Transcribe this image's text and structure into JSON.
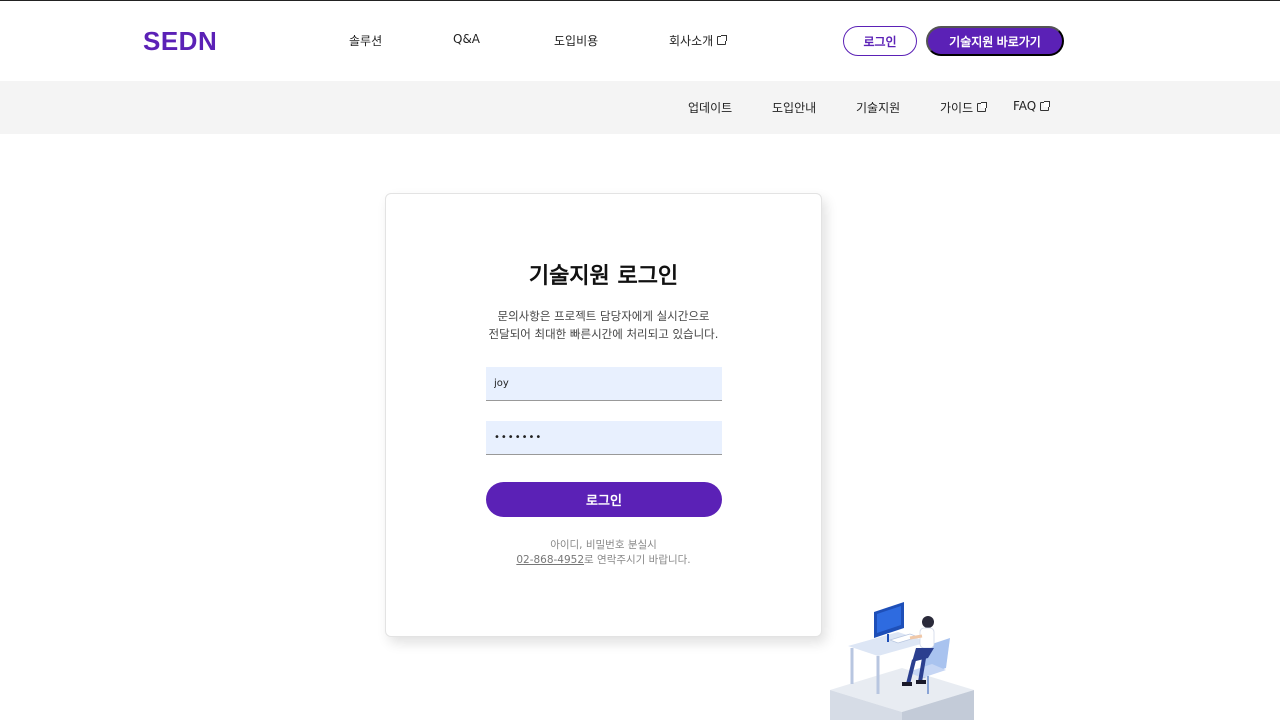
{
  "header": {
    "logo": "SEDN",
    "nav": [
      {
        "label": "솔루션",
        "external": false
      },
      {
        "label": "Q&A",
        "external": false
      },
      {
        "label": "도입비용",
        "external": false
      },
      {
        "label": "회사소개",
        "external": true
      }
    ],
    "login_button": "로그인",
    "tech_button": "기술지원 바로가기"
  },
  "subnav": [
    {
      "label": "업데이트",
      "external": false
    },
    {
      "label": "도입안내",
      "external": false
    },
    {
      "label": "기술지원",
      "external": false
    },
    {
      "label": "가이드",
      "external": true
    },
    {
      "label": "FAQ",
      "external": true
    }
  ],
  "login_card": {
    "title": "기술지원 로그인",
    "description_line1": "문의사항은 프로젝트 담당자에게 실시간으로",
    "description_line2": "전달되어 최대한 빠른시간에 처리되고 있습니다.",
    "username_value": "joy",
    "password_value": "•••••••",
    "submit_label": "로그인",
    "help_line1": "아이디, 비밀번호 분실시",
    "help_phone": "02-868-4952",
    "help_line2_suffix": "로 연락주시기 바랍니다."
  },
  "colors": {
    "brand": "#5b21b6",
    "input_bg": "#e8f0fe",
    "subbar_bg": "#f4f4f4"
  },
  "icons": {
    "external_link": "external-link-icon",
    "illustration": "support-agent-illustration"
  }
}
